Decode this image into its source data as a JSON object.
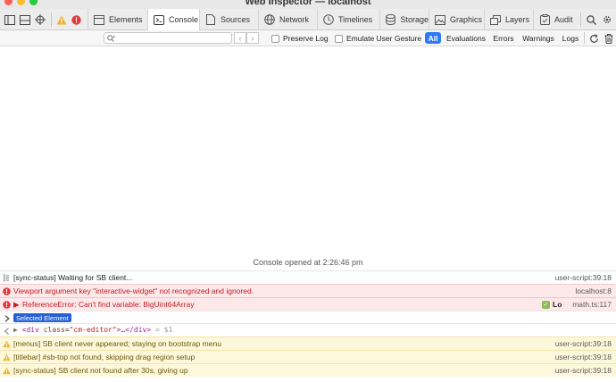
{
  "window": {
    "title": "Web Inspector — localhost"
  },
  "tabs": [
    {
      "label": "Elements",
      "icon": "elements-icon"
    },
    {
      "label": "Console",
      "icon": "console-icon",
      "active": true
    },
    {
      "label": "Sources",
      "icon": "sources-icon"
    },
    {
      "label": "Network",
      "icon": "network-icon"
    },
    {
      "label": "Timelines",
      "icon": "timelines-icon"
    },
    {
      "label": "Storage",
      "icon": "storage-icon"
    },
    {
      "label": "Graphics",
      "icon": "graphics-icon"
    },
    {
      "label": "Layers",
      "icon": "layers-icon"
    },
    {
      "label": "Audit",
      "icon": "audit-icon"
    }
  ],
  "filter": {
    "search_value": "",
    "preserve_log_label": "Preserve Log",
    "emulate_gesture_label": "Emulate User Gesture",
    "levels": [
      "All",
      "Evaluations",
      "Errors",
      "Warnings",
      "Logs"
    ],
    "selected_level": "All"
  },
  "console": {
    "session_text": "Console opened at 2:26:46 pm",
    "messages": [
      {
        "level": "log",
        "text": "[sync-status] Waiting for SB client...",
        "source": "user-script:39:18"
      },
      {
        "level": "error",
        "text": "Viewport argument key \"interactive-widget\" not recognized and ignored.",
        "source": "localhost:8"
      },
      {
        "level": "error",
        "text": "ReferenceError: Can't find variable: BigUint64Array",
        "source": "math.ts:117",
        "extra": "Lo"
      },
      {
        "level": "selected",
        "text": "Selected Element"
      },
      {
        "level": "element",
        "tag_open": "<div",
        "attr_name": "class",
        "attr_value": "\"cm-editor\"",
        "tag_rest": ">…</div>",
        "ref": "= $1"
      },
      {
        "level": "warn",
        "text": "[menus] SB client never appeared; staying on bootstrap menu",
        "source": "user-script:39:18"
      },
      {
        "level": "warn",
        "text": "[titlebar] #sb-top not found, skipping drag region setup",
        "source": "user-script:39:18"
      },
      {
        "level": "warn",
        "text": "[sync-status] SB client not found after 30s, giving up",
        "source": "user-script:39:18"
      }
    ]
  },
  "colors": {
    "accent": "#2d7bf4",
    "error_bg": "#fde9ea",
    "error_text": "#c11d24",
    "warn_bg": "#fdf8dc",
    "warn_icon": "#f0b429"
  }
}
